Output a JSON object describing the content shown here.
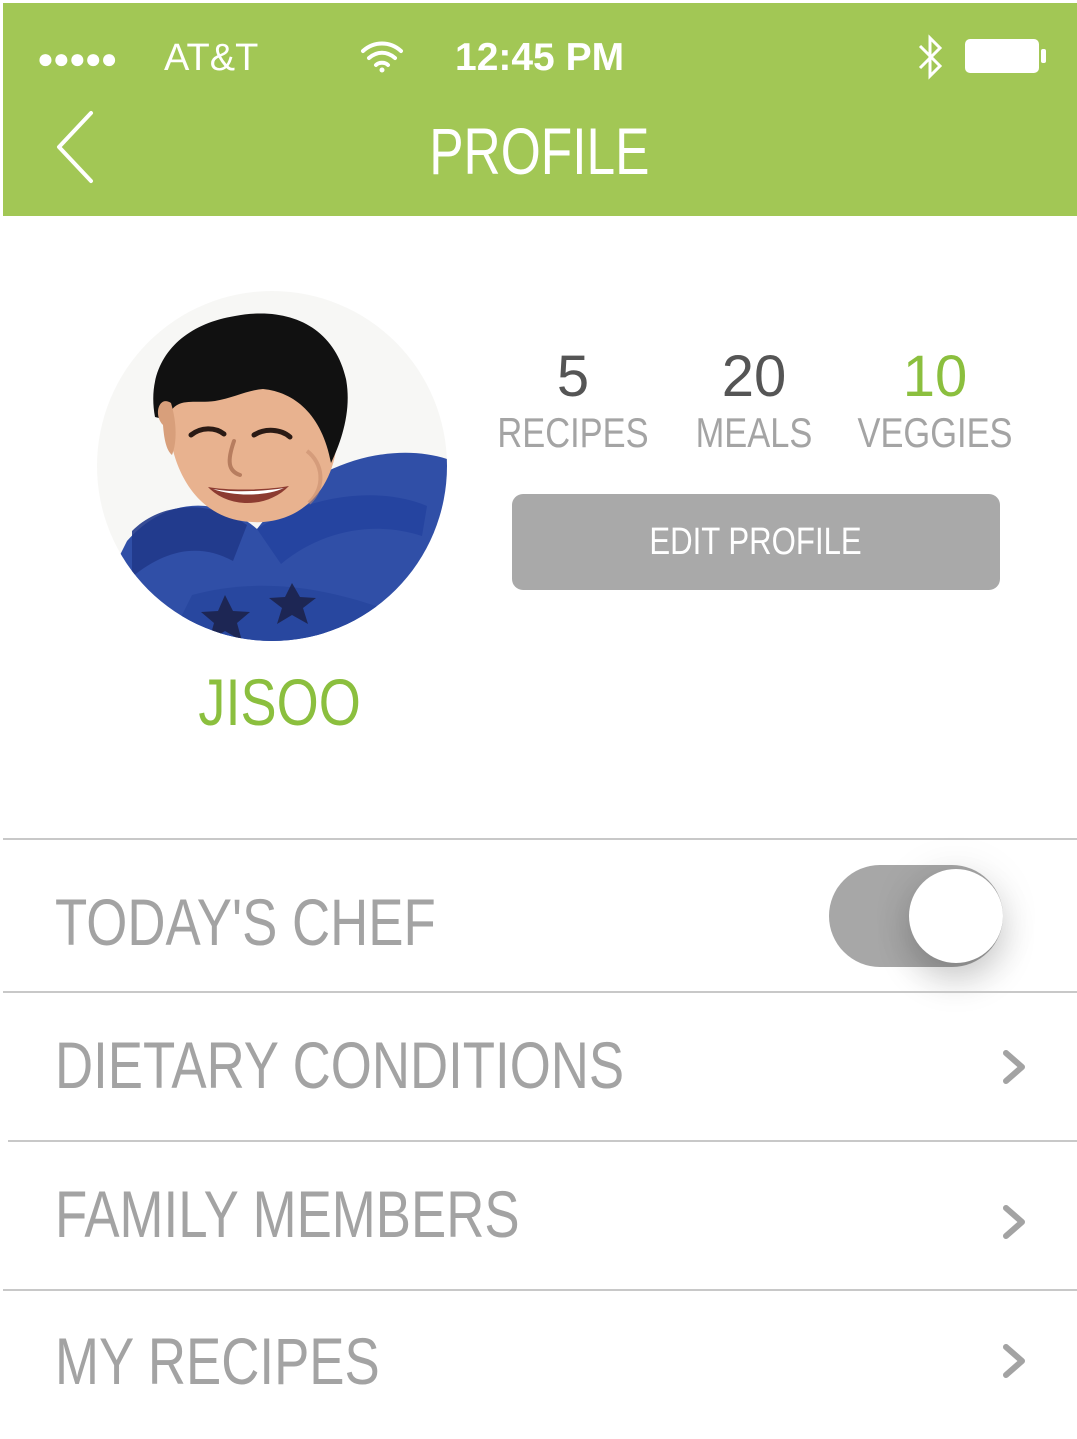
{
  "status_bar": {
    "signal": "●●●●●",
    "carrier": "AT&T",
    "time": "12:45 PM",
    "icons": [
      "wifi-icon",
      "bluetooth-icon",
      "battery-icon"
    ]
  },
  "header": {
    "title": "PROFILE",
    "back_icon": "chevron-left-icon",
    "background_color": "#a2c755"
  },
  "profile": {
    "name": "JISOO",
    "avatar_icon": "avatar-photo"
  },
  "stats": {
    "recipes": {
      "value": "5",
      "label": "RECIPES"
    },
    "meals": {
      "value": "20",
      "label": "MEALS"
    },
    "veggies": {
      "value": "10",
      "label": "VEGGIES"
    }
  },
  "actions": {
    "edit_profile": "EDIT PROFILE"
  },
  "menu": {
    "todays_chef": {
      "label": "TODAY'S CHEF",
      "toggle_on": true
    },
    "dietary_conditions": {
      "label": "DIETARY CONDITIONS",
      "icon": "chevron-right-icon"
    },
    "family_members": {
      "label": "FAMILY MEMBERS",
      "icon": "chevron-right-icon"
    },
    "my_recipes": {
      "label": "MY RECIPES",
      "icon": "chevron-right-icon"
    }
  },
  "colors": {
    "accent": "#8bbf3e",
    "toggle_track": "#a7a7a7",
    "button": "#a9a9a9",
    "muted_text": "#a3a3a3"
  }
}
